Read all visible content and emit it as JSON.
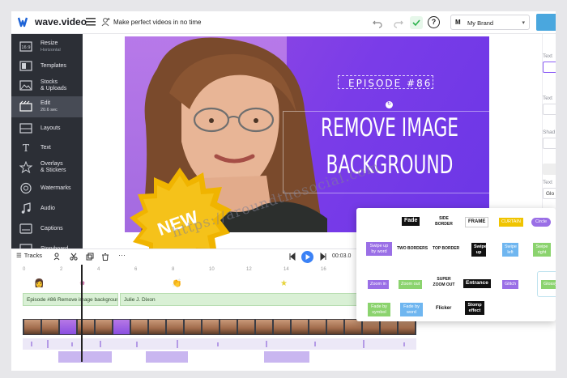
{
  "app": {
    "logo_text": "wave.video",
    "project_title": "Make perfect videos in no time"
  },
  "brand": {
    "initial": "M",
    "name": "My Brand"
  },
  "help_label": "?",
  "sidebar": {
    "items": [
      {
        "label": "Resize",
        "sub": "Horizontal",
        "icon": "resize-icon"
      },
      {
        "label": "Templates",
        "sub": "",
        "icon": "templates-icon"
      },
      {
        "label": "Stocks",
        "label2": "& Uploads",
        "icon": "image-icon"
      },
      {
        "label": "Edit",
        "sub": "20.6 sec",
        "icon": "edit-icon",
        "active": true
      },
      {
        "label": "Layouts",
        "icon": "layouts-icon"
      },
      {
        "label": "Text",
        "icon": "text-icon"
      },
      {
        "label": "Overlays",
        "label2": "& Stickers",
        "icon": "star-icon"
      },
      {
        "label": "Watermarks",
        "icon": "watermark-icon"
      },
      {
        "label": "Audio",
        "icon": "music-icon"
      },
      {
        "label": "Captions",
        "icon": "captions-icon"
      },
      {
        "label": "Storyboard",
        "icon": "storyboard-icon"
      }
    ]
  },
  "canvas": {
    "episode_label": "EPISODE #86",
    "headline_1": "REMOVE IMAGE",
    "headline_2": "BACKGROUND",
    "badge": "NEW"
  },
  "right_panel": {
    "labels": [
      "Text",
      "Text",
      "Shad",
      "Text"
    ],
    "font_value": "Glo"
  },
  "timeline": {
    "tracks_label": "Tracks",
    "time": "00:03.0",
    "ruler": [
      "0",
      "2",
      "4",
      "6",
      "8",
      "10",
      "12",
      "14",
      "16"
    ],
    "clip_1": "Episode #86 Remove image background",
    "clip_2": "Julie J. Dixon"
  },
  "transitions": {
    "row1": [
      "Fade",
      "SIDE BORDER",
      "FRAME",
      "CURTAIN",
      "Circle"
    ],
    "row2": [
      "Swipe up by word",
      "TWO BORDERS",
      "TOP BORDER",
      "Swipe up",
      "Swipe left",
      "Swipe right"
    ],
    "row3": [
      "Zoom in",
      "Zoom out",
      "SUPER ZOOM OUT",
      "Entrance",
      "Glitch",
      "Glossy"
    ],
    "row4": [
      "Fade by symbol",
      "Fade by word",
      "Flicker",
      "Stomp effect"
    ]
  },
  "watermark": "https://aroundthesocial.com",
  "colors": {
    "purple": "#7a3ce8",
    "sidebar": "#2c2f36",
    "accent_blue": "#3b82f6",
    "badge_gold": "#f0b400"
  }
}
